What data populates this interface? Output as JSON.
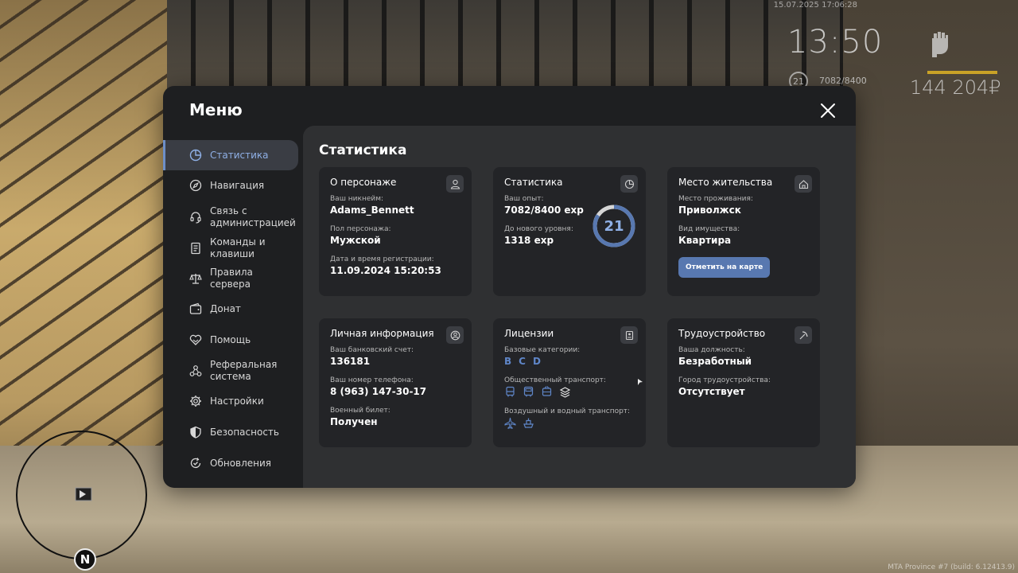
{
  "hud": {
    "datetime": "15.07.2025 17:06:28",
    "clock": "13:50",
    "level": "21",
    "exp": "7082/8400",
    "money": "144 204₽",
    "build": "MTA Province #7 (build: 6.12413.9)",
    "compass": "N"
  },
  "menu": {
    "title": "Меню",
    "sidebar": [
      {
        "label": "Статистика",
        "icon": "pie-chart-icon",
        "active": true
      },
      {
        "label": "Навигация",
        "icon": "compass-icon"
      },
      {
        "label": "Связь с администрацией",
        "icon": "headset-icon"
      },
      {
        "label": "Команды и клавиши",
        "icon": "document-icon"
      },
      {
        "label": "Правила сервера",
        "icon": "scales-icon"
      },
      {
        "label": "Донат",
        "icon": "wallet-icon"
      },
      {
        "label": "Помощь",
        "icon": "handshake-heart-icon"
      },
      {
        "label": "Реферальная система",
        "icon": "network-icon"
      },
      {
        "label": "Настройки",
        "icon": "gear-icon"
      },
      {
        "label": "Безопасность",
        "icon": "shield-icon"
      },
      {
        "label": "Обновления",
        "icon": "refresh-check-icon"
      }
    ],
    "content_title": "Статистика",
    "character": {
      "title": "О персонаже",
      "nickname_label": "Ваш никнейм:",
      "nickname": "Adams_Bennett",
      "gender_label": "Пол персонажа:",
      "gender": "Мужской",
      "reg_label": "Дата и время регистрации:",
      "reg": "11.09.2024 15:20:53"
    },
    "stats": {
      "title": "Статистика",
      "exp_label": "Ваш опыт:",
      "exp": "7082/8400 exp",
      "next_label": "До нового уровня:",
      "next": "1318 exp",
      "level": "21",
      "progress": 0.843
    },
    "residence": {
      "title": "Место жительства",
      "city_label": "Место проживания:",
      "city": "Приволжск",
      "property_label": "Вид имущества:",
      "property": "Квартира",
      "button": "Отметить на карте"
    },
    "personal": {
      "title": "Личная информация",
      "bank_label": "Ваш банковский счет:",
      "bank": "136181",
      "phone_label": "Ваш номер телефона:",
      "phone": "8 (963) 147-30-17",
      "military_label": "Военный билет:",
      "military": "Получен"
    },
    "licenses": {
      "title": "Лицензии",
      "basic_label": "Базовые категории:",
      "categories": [
        "B",
        "C",
        "D"
      ],
      "public_label": "Общественный транспорт:",
      "air_label": "Воздушный и водный транспорт:"
    },
    "employment": {
      "title": "Трудоустройство",
      "position_label": "Ваша должность:",
      "position": "Безработный",
      "city_label": "Город трудоустройства:",
      "city": "Отсутствует"
    }
  },
  "colors": {
    "accent": "#6d8fc7",
    "button": "#5878b0",
    "card": "#232427",
    "panel": "#2f3032",
    "window": "#1e1f21",
    "money_bar": "#c9a227"
  }
}
